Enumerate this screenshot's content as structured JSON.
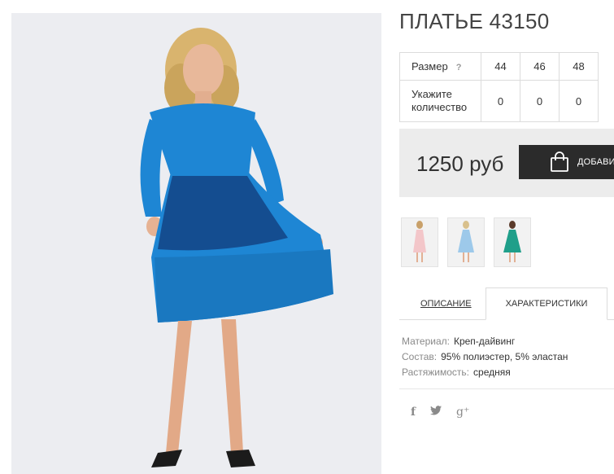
{
  "product": {
    "title": "ПЛАТЬЕ 43150",
    "image_icon": "product-photo",
    "dress_color": "#1e86d4"
  },
  "size_table": {
    "size_label": "Размер",
    "help_mark": "?",
    "quantity_label": "Укажите количество",
    "sizes": [
      "44",
      "46",
      "48"
    ],
    "quantities": [
      "0",
      "0",
      "0"
    ]
  },
  "price_box": {
    "price": "1250 руб",
    "buy_label": "ДОБАВИТЬ",
    "buy_icon": "shopping-bag-icon"
  },
  "thumbnails": [
    {
      "color": "#f3c6c9",
      "icon": "pink-dress-thumbnail"
    },
    {
      "color": "#9dc9ea",
      "icon": "light-blue-dress-thumbnail"
    },
    {
      "color": "#1f9f8a",
      "icon": "teal-dress-thumbnail"
    }
  ],
  "tabs": {
    "description": "ОПИСАНИЕ",
    "characteristics": "ХАРАКТЕРИСТИКИ"
  },
  "specs": [
    {
      "label": "Материал:",
      "value": "Креп-дайвинг"
    },
    {
      "label": "Состав:",
      "value": "95% полиэстер, 5% эластан"
    },
    {
      "label": "Растяжимость:",
      "value": "средняя"
    }
  ],
  "social": {
    "facebook": "f",
    "twitter": "🐦",
    "google_plus": "g⁺"
  }
}
